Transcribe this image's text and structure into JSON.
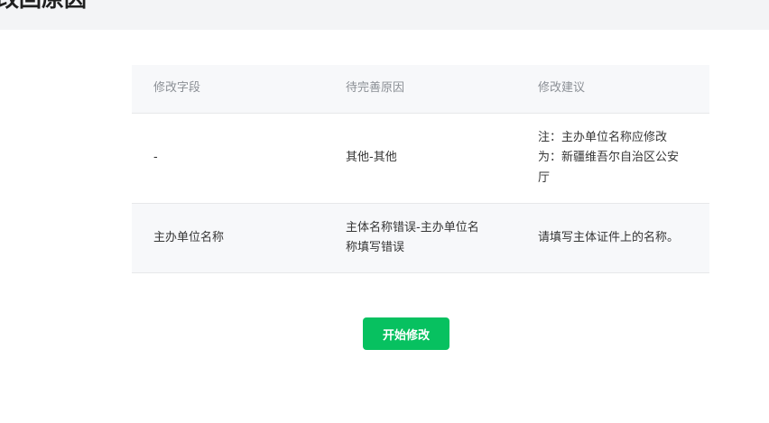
{
  "header": {
    "title": "改回原因"
  },
  "table": {
    "columns": [
      "修改字段",
      "待完善原因",
      "修改建议"
    ],
    "rows": [
      [
        "-",
        "其他-其他",
        "注：主办单位名称应修改为：新疆维吾尔自治区公安厅"
      ],
      [
        "主办单位名称",
        "主体名称错误-主办单位名称填写错误",
        "请填写主体证件上的名称。"
      ]
    ]
  },
  "actions": {
    "start_label": "开始修改",
    "accent_color": "#07c160"
  }
}
